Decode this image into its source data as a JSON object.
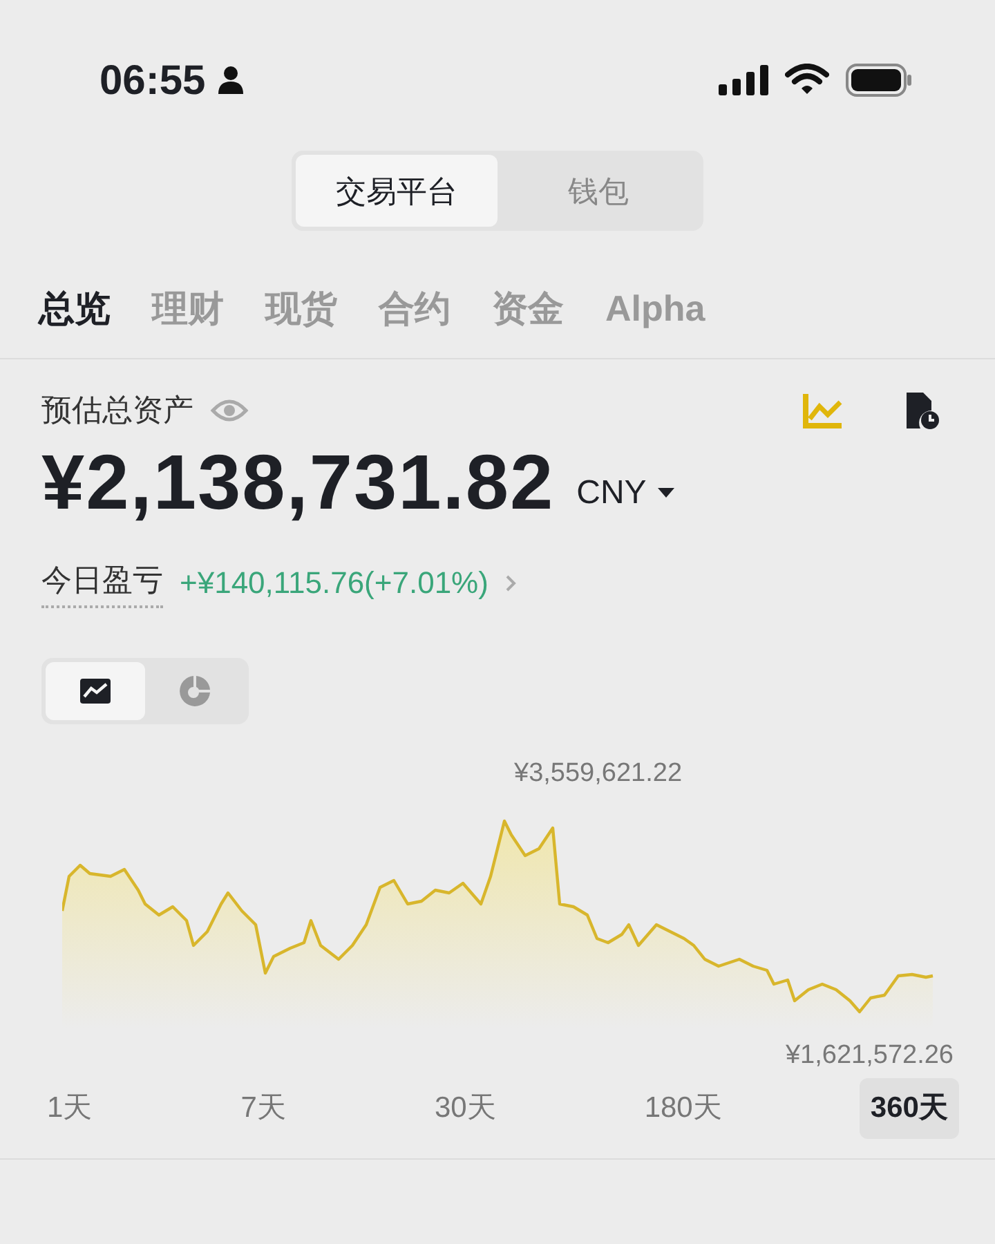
{
  "status_bar": {
    "time": "06:55"
  },
  "segmented": [
    {
      "label": "交易平台",
      "selected": true
    },
    {
      "label": "钱包",
      "selected": false
    }
  ],
  "tabs": [
    {
      "label": "总览",
      "selected": true
    },
    {
      "label": "理财",
      "selected": false
    },
    {
      "label": "现货",
      "selected": false
    },
    {
      "label": "合约",
      "selected": false
    },
    {
      "label": "资金",
      "selected": false
    },
    {
      "label": "Alpha",
      "selected": false
    }
  ],
  "balance": {
    "label": "预估总资产",
    "amount": "¥2,138,731.82",
    "currency": "CNY",
    "pnl_label": "今日盈亏",
    "pnl_value": "+¥140,115.76(+7.01%)"
  },
  "chart_view": [
    {
      "kind": "line",
      "selected": true
    },
    {
      "kind": "pie",
      "selected": false
    }
  ],
  "chart": {
    "max_label": "¥3,559,621.22",
    "min_label": "¥1,621,572.26"
  },
  "ranges": [
    {
      "label": "1天",
      "selected": false
    },
    {
      "label": "7天",
      "selected": false
    },
    {
      "label": "30天",
      "selected": false
    },
    {
      "label": "180天",
      "selected": false
    },
    {
      "label": "360天",
      "selected": true
    }
  ]
}
